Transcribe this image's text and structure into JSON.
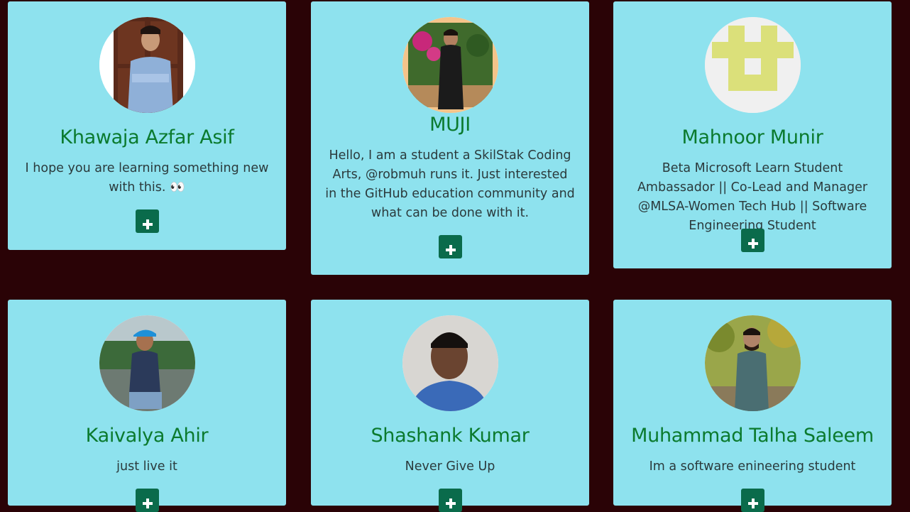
{
  "page": {
    "background": "#2a0306",
    "card_background": "#8ee2ee",
    "name_color": "#0b7a2e",
    "button_color": "#0a6b4b"
  },
  "cards": [
    {
      "name": "Khawaja Azfar Asif",
      "bio": "I hope you are learning something new with this. 👀",
      "avatar_icon": "person-photo",
      "button_icon": "plus-icon"
    },
    {
      "name": "MUJI",
      "bio": "Hello, I am a student a SkilStak Coding Arts, @robmuh runs it. Just interested in the GitHub education community and what can be done with it.",
      "avatar_icon": "person-photo",
      "button_icon": "plus-icon"
    },
    {
      "name": "Mahnoor Munir",
      "bio": "Beta Microsoft Learn Student Ambassador || Co-Lead and Manager @MLSA-Women Tech Hub || Software Engineering Student",
      "avatar_icon": "identicon",
      "button_icon": "plus-icon"
    },
    {
      "name": "Kaivalya Ahir",
      "bio": "just live it",
      "avatar_icon": "person-photo",
      "button_icon": "plus-icon"
    },
    {
      "name": "Shashank Kumar",
      "bio": "Never Give Up",
      "avatar_icon": "person-photo",
      "button_icon": "plus-icon"
    },
    {
      "name": "Muhammad Talha Saleem",
      "bio": "Im a software enineering student",
      "avatar_icon": "person-photo",
      "button_icon": "plus-icon"
    }
  ]
}
